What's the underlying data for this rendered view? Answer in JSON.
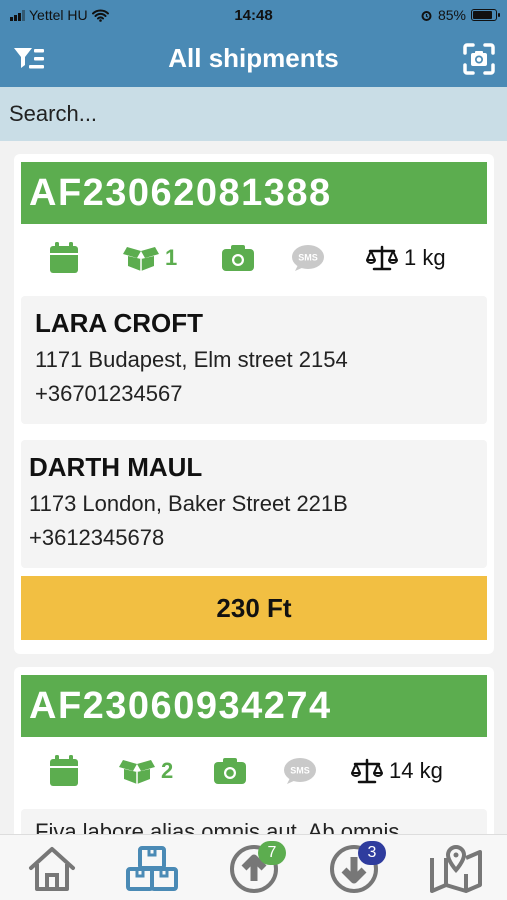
{
  "status": {
    "carrier": "Yettel HU",
    "time": "14:48",
    "battery": "85%",
    "battery_level": 0.85
  },
  "header": {
    "title": "All shipments"
  },
  "search": {
    "placeholder": "Search..."
  },
  "shipments": [
    {
      "code": "AF23062081388",
      "packages": "1",
      "weight": "1 kg",
      "sender": {
        "name": "LARA CROFT",
        "address": "1171 Budapest, Elm street 2154",
        "phone": "+36701234567"
      },
      "recipient": {
        "name": "DARTH MAUL",
        "address": "1173 London, Baker Street 221B",
        "phone": "+3612345678"
      },
      "price": "230 Ft"
    },
    {
      "code": "AF23060934274",
      "packages": "2",
      "weight": "14 kg",
      "note": "Fiva labore alias omnis aut. Ab omnis"
    }
  ],
  "tabs": {
    "upload_count": "7",
    "download_count": "3"
  },
  "colors": {
    "header": "#4a8ab5",
    "green": "#5cad4f",
    "price": "#f2bf42",
    "upload_badge": "#5cad4f",
    "download_badge": "#2f3c9e",
    "sms_gray": "#c9c9c9"
  }
}
